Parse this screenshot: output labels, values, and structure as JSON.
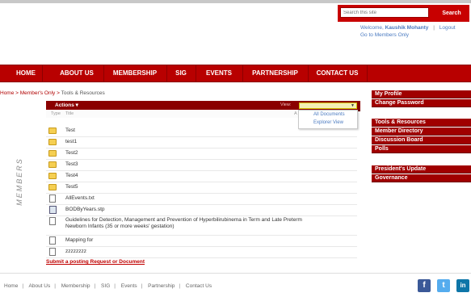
{
  "search": {
    "placeholder": "Search this site",
    "button_label": "Search"
  },
  "user": {
    "welcome_prefix": "Welcome,",
    "name": "Kaushik Mohanty",
    "separator": "|",
    "logout_label": "Logout",
    "goto_label": "Go to Members Only"
  },
  "nav": {
    "items": [
      "HOME",
      "ABOUT US",
      "MEMBERSHIP",
      "SIG",
      "EVENTS",
      "PARTNERSHIP",
      "CONTACT US"
    ]
  },
  "breadcrumb": {
    "root": "Home",
    "sep": ">",
    "mid": "Member's Only",
    "current": "Tools & Resources"
  },
  "side_label": "MEMBERS",
  "toolbar": {
    "actions_label": "Actions ▾",
    "view_label": "View:"
  },
  "view_dropdown": {
    "options": [
      "All Documents",
      "Explorer View"
    ]
  },
  "list": {
    "headers": {
      "type": "Type",
      "title": "Title",
      "modified": "A"
    },
    "items": [
      {
        "type": "folder",
        "title": "Test"
      },
      {
        "type": "folder",
        "title": "test1"
      },
      {
        "type": "folder",
        "title": "Test2"
      },
      {
        "type": "folder",
        "title": "Test3"
      },
      {
        "type": "folder",
        "title": "Test4"
      },
      {
        "type": "folder",
        "title": "Test5"
      },
      {
        "type": "text",
        "title": "AllEvents.txt"
      },
      {
        "type": "image",
        "title": "BODByYears.stp"
      },
      {
        "type": "document",
        "title": "Guidelines for Detection, Management and Prevention of Hyperbilirubinema in Term and Late Preterm Newborn Infants (35 or more weeks' gestation)"
      },
      {
        "type": "document",
        "title": "Mapping for"
      },
      {
        "type": "document",
        "title": "zzzzzzzz"
      }
    ]
  },
  "submit_link": "Submit a posting Request or Document",
  "right_panel": {
    "groups": [
      [
        "My Profile",
        "Change Password"
      ],
      [
        "Tools & Resources",
        "Member Directory",
        "Discussion Board",
        "Polls"
      ],
      [
        "President's Update",
        "Governance"
      ]
    ]
  },
  "footer": {
    "links": [
      "Home",
      "About Us",
      "Membership",
      "SIG",
      "Events",
      "Partnership",
      "Contact Us"
    ]
  },
  "social": {
    "facebook": "f",
    "twitter": "t",
    "linkedin": "in"
  },
  "colors": {
    "brand_red": "#b80000",
    "dark_red": "#8a0000",
    "link_blue": "#4a7ac0"
  }
}
